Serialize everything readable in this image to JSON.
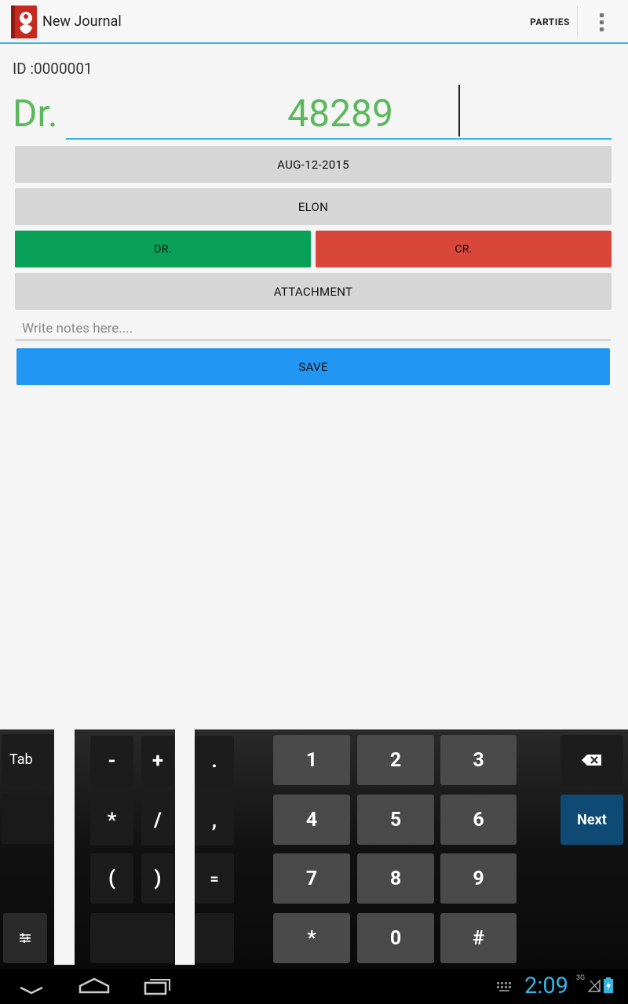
{
  "app": {
    "title": "New Journal",
    "icon_name": "ganesha-book-icon"
  },
  "actionbar": {
    "parties_label": "PARTIES",
    "overflow_icon": "more-vert-icon"
  },
  "form": {
    "id_label": "ID :0000001",
    "type_prefix": "Dr.",
    "amount": "48289",
    "date_button": "AUG-12-2015",
    "party_button": "ELON",
    "dr_button": "DR.",
    "cr_button": "CR.",
    "attachment_button": "ATTACHMENT",
    "notes_placeholder": "Write notes here....",
    "notes_value": "",
    "save_button": "SAVE"
  },
  "keyboard": {
    "tab": "Tab",
    "symbols": [
      "-",
      "+",
      ".",
      "*",
      "/",
      ",",
      "(",
      ")",
      "="
    ],
    "digits": [
      "1",
      "2",
      "3",
      "4",
      "5",
      "6",
      "7",
      "8",
      "9",
      "*",
      "0",
      "#"
    ],
    "next": "Next",
    "backspace_icon": "backspace-icon",
    "settings_icon": "keyboard-settings-icon"
  },
  "navbar": {
    "back_icon": "back-icon",
    "home_icon": "home-icon",
    "recents_icon": "recent-apps-icon",
    "keyboard_icon": "keyboard-icon",
    "clock": "2:09",
    "network": "3G"
  },
  "colors": {
    "accent": "#33b5e5",
    "dr_green": "#09a058",
    "cr_red": "#d9473b",
    "save_blue": "#2196f3",
    "amount_green": "#5cb85c"
  }
}
